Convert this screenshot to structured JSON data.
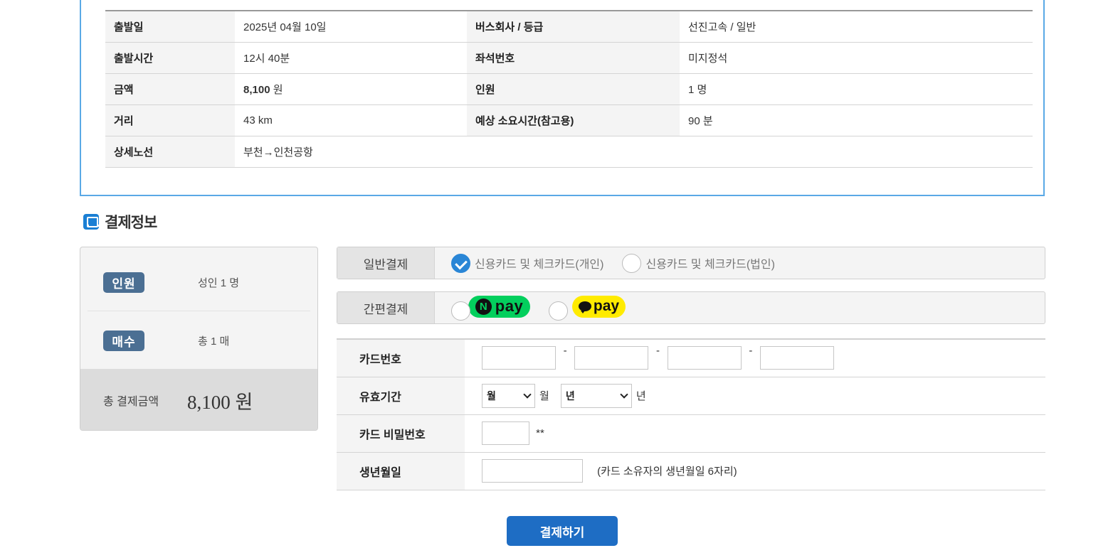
{
  "trip": {
    "depart_date_label": "출발일",
    "depart_date": "2025년 04월 10일",
    "bus_company_label": "버스회사 / 등급",
    "bus_company": "선진고속 / 일반",
    "depart_time_label": "출발시간",
    "depart_time": "12시 40분",
    "seat_label": "좌석번호",
    "seat": "미지정석",
    "amount_label": "금액",
    "amount": "8,100",
    "amount_unit": " 원",
    "persons_label": "인원",
    "persons": "1 명",
    "distance_label": "거리",
    "distance": "43 km",
    "duration_label": "예상 소요시간(참고용)",
    "duration": "90 분",
    "route_label": "상세노선",
    "route": "부천→인천공항"
  },
  "payment_section": {
    "title": "결제정보",
    "summary": {
      "persons_badge": "인원",
      "persons_value": "성인 1 명",
      "tickets_badge": "매수",
      "tickets_value": "총 1 매",
      "total_label": "총 결제금액",
      "total_value": "8,100 원"
    },
    "general": {
      "label": "일반결제",
      "option_personal": "신용카드 및 체크카드(개인)",
      "option_corporate": "신용카드 및 체크카드(법인)"
    },
    "easy": {
      "label": "간편결제",
      "npay_n": "N",
      "npay_text": "pay",
      "kpay_text": "pay"
    },
    "card": {
      "number_label": "카드번호",
      "number_dash": "-",
      "expiry_label": "유효기간",
      "month_select": "월",
      "month_unit": "월",
      "year_select": "년",
      "year_unit": "년",
      "password_label": "카드 비밀번호",
      "password_suffix": "**",
      "birth_label": "생년월일",
      "birth_note": "(카드 소유자의 생년월일 6자리)"
    },
    "submit_label": "결제하기"
  },
  "colors": {
    "accent": "#1e6dc4",
    "border_blue": "#5aa9e6",
    "badge": "#4b6f93",
    "npay": "#03cf5d",
    "kpay": "#ffeb00"
  }
}
